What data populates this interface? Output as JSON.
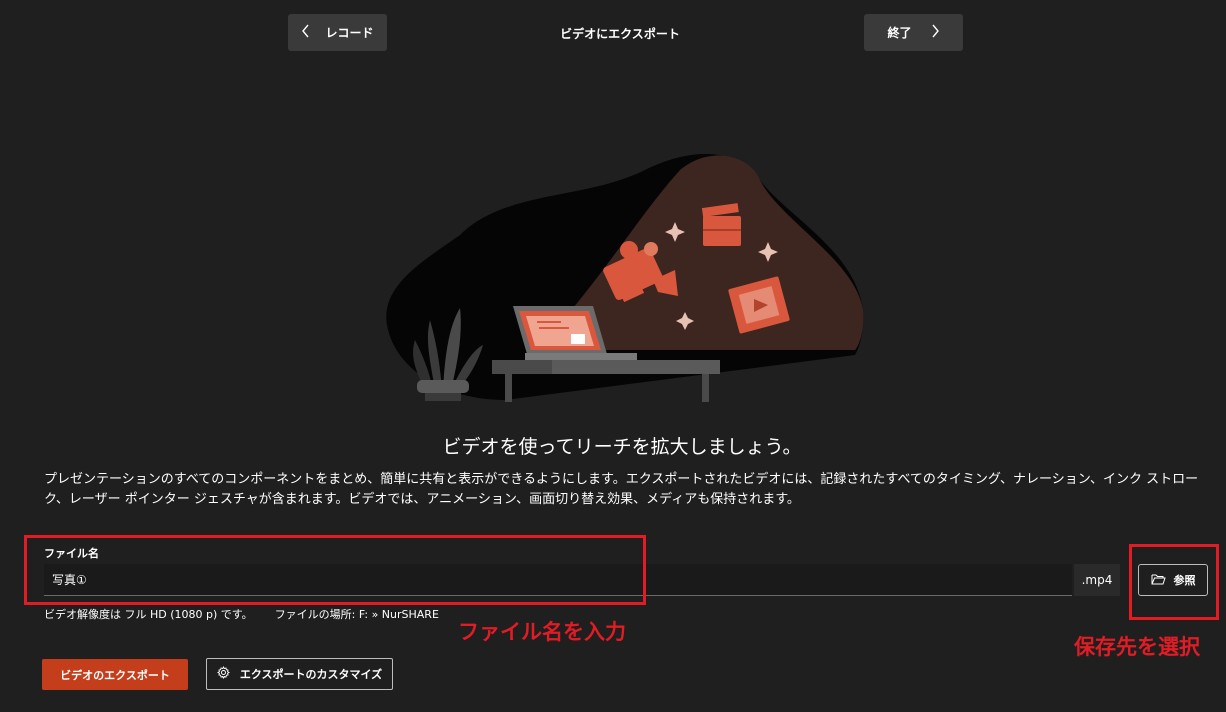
{
  "header": {
    "back_label": "レコード",
    "title": "ビデオにエクスポート",
    "finish_label": "終了"
  },
  "main": {
    "headline": "ビデオを使ってリーチを拡大しましょう。",
    "description": "プレゼンテーションのすべてのコンポーネントをまとめ、簡単に共有と表示ができるようにします。エクスポートされたビデオには、記録されたすべてのタイミング、ナレーション、インク ストローク、レーザー ポインター ジェスチャが含まれます。ビデオでは、アニメーション、画面切り替え効果、メディアも保持されます。"
  },
  "file": {
    "label": "ファイル名",
    "value": "写真①",
    "extension": ".mp4",
    "browse_label": "参照",
    "resolution_info": "ビデオ解像度は フル HD (1080 p) です。",
    "location_prefix": "ファイルの場所:",
    "location_path": "F: » NurSHARE"
  },
  "actions": {
    "export_label": "ビデオのエクスポート",
    "customize_label": "エクスポートのカスタマイズ"
  },
  "annotations": {
    "filename_note": "ファイル名を入力",
    "browse_note": "保存先を選択"
  },
  "icons": {
    "back": "chevron-left-icon",
    "finish": "chevron-right-icon",
    "browse": "folder-open-icon",
    "customize": "gear-icon"
  },
  "colors": {
    "background": "#1f1f1f",
    "accent": "#c43e1c",
    "annotation": "#e11c24",
    "button": "#3a3a3a"
  }
}
